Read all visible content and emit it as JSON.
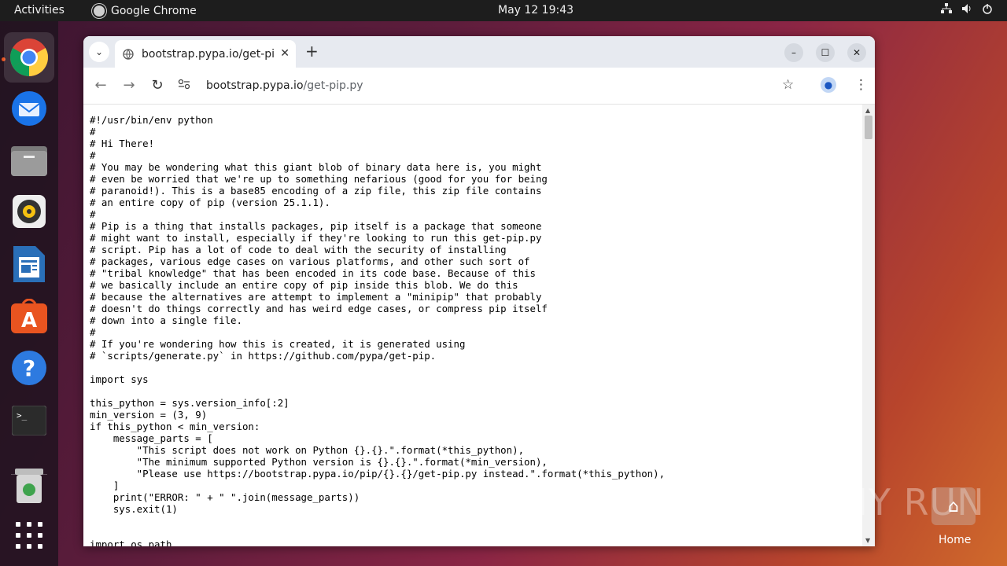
{
  "topbar": {
    "activities": "Activities",
    "app_name": "Google Chrome",
    "clock": "May 12  19:43",
    "tray_icons": [
      "network-icon",
      "volume-icon",
      "power-icon"
    ]
  },
  "dock": {
    "apps": [
      "Google Chrome",
      "Thunderbird Mail",
      "Files",
      "Rhythmbox",
      "LibreOffice Writer",
      "Ubuntu Software",
      "Help",
      "Terminal",
      "Trash",
      "Show Applications"
    ]
  },
  "browser": {
    "tab_title": "bootstrap.pypa.io/get-pi",
    "url_host": "bootstrap.pypa.io",
    "url_path": "/get-pip.py"
  },
  "page": {
    "code": "#!/usr/bin/env python\n#\n# Hi There!\n#\n# You may be wondering what this giant blob of binary data here is, you might\n# even be worried that we're up to something nefarious (good for you for being\n# paranoid!). This is a base85 encoding of a zip file, this zip file contains\n# an entire copy of pip (version 25.1.1).\n#\n# Pip is a thing that installs packages, pip itself is a package that someone\n# might want to install, especially if they're looking to run this get-pip.py\n# script. Pip has a lot of code to deal with the security of installing\n# packages, various edge cases on various platforms, and other such sort of\n# \"tribal knowledge\" that has been encoded in its code base. Because of this\n# we basically include an entire copy of pip inside this blob. We do this\n# because the alternatives are attempt to implement a \"minipip\" that probably\n# doesn't do things correctly and has weird edge cases, or compress pip itself\n# down into a single file.\n#\n# If you're wondering how this is created, it is generated using\n# `scripts/generate.py` in https://github.com/pypa/get-pip.\n\nimport sys\n\nthis_python = sys.version_info[:2]\nmin_version = (3, 9)\nif this_python < min_version:\n    message_parts = [\n        \"This script does not work on Python {}.{}.\".format(*this_python),\n        \"The minimum supported Python version is {}.{}.\".format(*min_version),\n        \"Please use https://bootstrap.pypa.io/pip/{}.{}/get-pip.py instead.\".format(*this_python),\n    ]\n    print(\"ERROR: \" + \" \".join(message_parts))\n    sys.exit(1)\n\n\nimport os.path"
  },
  "desktop": {
    "watermark": "ANY RUN",
    "home_label": "Home"
  }
}
